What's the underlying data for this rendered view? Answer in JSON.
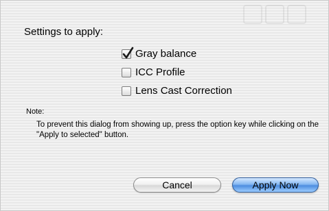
{
  "dialog": {
    "heading": "Settings to apply:",
    "options": [
      {
        "label": "Gray balance",
        "checked": true
      },
      {
        "label": "ICC Profile",
        "checked": false
      },
      {
        "label": "Lens Cast Correction",
        "checked": false
      }
    ],
    "note": {
      "title": "Note:",
      "text": "To prevent this dialog from showing up, press the option key while clicking on the \"Apply to selected\" button."
    },
    "buttons": {
      "cancel_label": "Cancel",
      "apply_label": "Apply Now"
    }
  },
  "colors": {
    "default_button": "#4d8ee0",
    "background_stripe_light": "#f3f3f3",
    "background_stripe_dark": "#e8e8e8"
  },
  "icons": {
    "checkmark": "checkmark-icon"
  }
}
